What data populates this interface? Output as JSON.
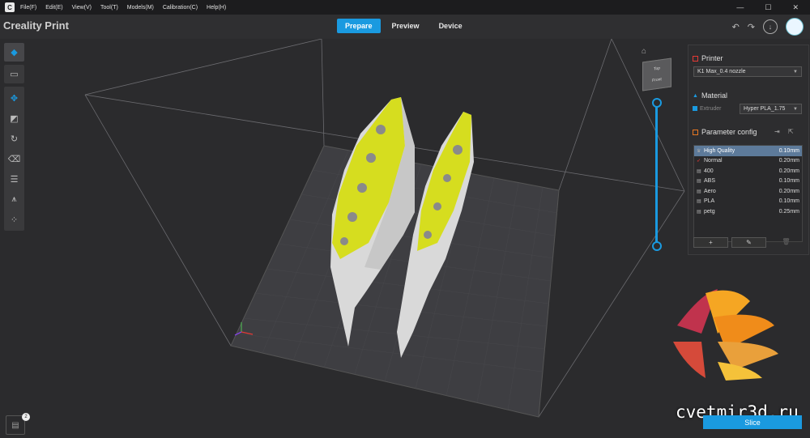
{
  "menubar": {
    "items": [
      "File(F)",
      "Edit(E)",
      "View(V)",
      "Tool(T)",
      "Models(M)",
      "Calibration(C)",
      "Help(H)"
    ],
    "controls": [
      "—",
      "☐",
      "✕"
    ]
  },
  "header": {
    "app_title": "Creality Print",
    "tabs": [
      {
        "label": "Prepare"
      },
      {
        "label": "Preview"
      },
      {
        "label": "Device"
      }
    ]
  },
  "viewcube": {
    "top_label": "Top",
    "front_label": "Front"
  },
  "panel": {
    "printer": {
      "title": "Printer",
      "value": "K1 Max_0.4 nozzle"
    },
    "material": {
      "title": "Material",
      "extruder_label": "Extruder",
      "value": "Hyper PLA_1.75"
    },
    "param": {
      "title": "Parameter config",
      "profiles": [
        {
          "name": "High Quality",
          "value": "0.10mm",
          "icon": "crown-icon"
        },
        {
          "name": "Normal",
          "value": "0.20mm",
          "icon": "rocket-icon"
        },
        {
          "name": "400",
          "value": "0.20mm",
          "icon": "doc-icon"
        },
        {
          "name": "ABS",
          "value": "0.10mm",
          "icon": "doc-icon"
        },
        {
          "name": "Aero",
          "value": "0.20mm",
          "icon": "doc-icon"
        },
        {
          "name": "PLA",
          "value": "0.10mm",
          "icon": "doc-icon"
        },
        {
          "name": "petg",
          "value": "0.25mm",
          "icon": "doc-icon"
        }
      ],
      "buttons": [
        "+",
        "✎",
        "🗑"
      ]
    }
  },
  "slice_label": "Slice",
  "watermark": "cvetmir3d.ru",
  "doc_badge": "2",
  "colors": {
    "accent": "#1a9ae0",
    "bed": "#3e3e42",
    "model_fill": "#d6dd1f"
  }
}
